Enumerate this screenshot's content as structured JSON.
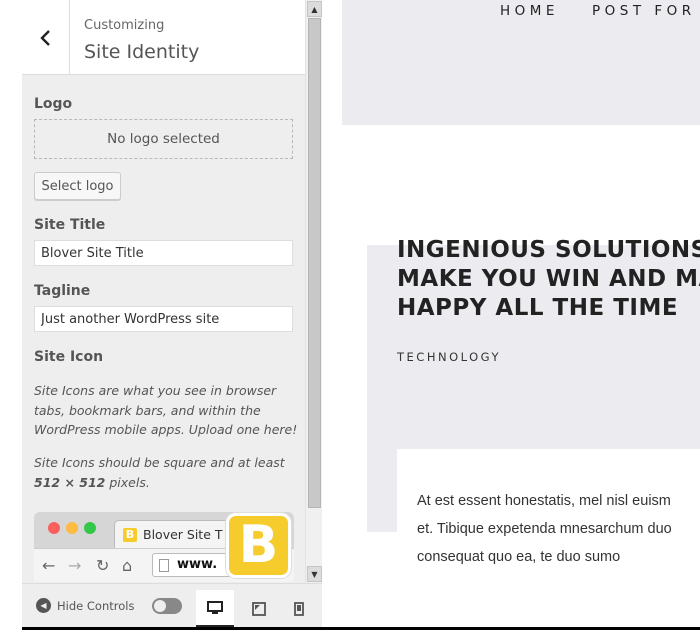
{
  "header": {
    "customizing": "Customizing",
    "section_title": "Site Identity"
  },
  "logo": {
    "label": "Logo",
    "empty_text": "No logo selected",
    "select_button": "Select logo"
  },
  "site_title": {
    "label": "Site Title",
    "value": "Blover Site Title"
  },
  "tagline": {
    "label": "Tagline",
    "value": "Just another WordPress site"
  },
  "site_icon": {
    "label": "Site Icon",
    "description_1": "Site Icons are what you see in browser tabs, bookmark bars, and within the WordPress mobile apps. Upload one here!",
    "description_2_prefix": "Site Icons should be square and at least ",
    "description_2_size": "512 × 512",
    "description_2_suffix": " pixels.",
    "preview_tab_title": "Blover Site T",
    "preview_url": "www.",
    "favicon_letter": "B",
    "favicon_color": "#f5cc2b"
  },
  "footer": {
    "hide_controls": "Hide Controls",
    "devices": [
      "desktop-icon",
      "tablet-icon",
      "mobile-icon"
    ]
  },
  "site": {
    "nav": [
      "HOME",
      "POST FOR"
    ],
    "post_title_lines": [
      "INGENIOUS SOLUTIONS",
      "MAKE YOU WIN AND MA",
      "HAPPY ALL THE TIME"
    ],
    "category": "TECHNOLOGY",
    "excerpt_lines": [
      "At est essent honestatis, mel nisl euism",
      "et. Tibique expetenda mnesarchum duo",
      "consequat quo ea, te duo sumo"
    ]
  }
}
